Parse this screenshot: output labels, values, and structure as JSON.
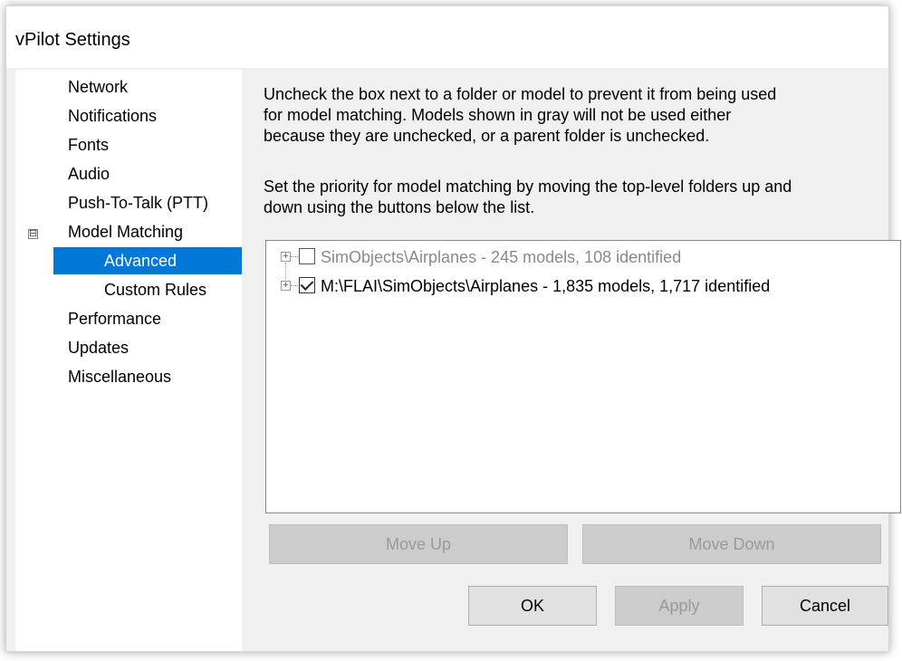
{
  "window": {
    "title": "vPilot Settings"
  },
  "nav": {
    "items": [
      {
        "label": "Network"
      },
      {
        "label": "Notifications"
      },
      {
        "label": "Fonts"
      },
      {
        "label": "Audio"
      },
      {
        "label": "Push-To-Talk (PTT)"
      },
      {
        "label": "Model Matching",
        "expander": "⊟"
      },
      {
        "label": "Advanced",
        "selected": true
      },
      {
        "label": "Custom Rules"
      },
      {
        "label": "Performance"
      },
      {
        "label": "Updates"
      },
      {
        "label": "Miscellaneous"
      }
    ]
  },
  "main": {
    "description_lines": [
      "Uncheck the box next to a folder or model to prevent it from being used",
      "for model matching. Models shown in gray will not be used either",
      "because they are unchecked, or a parent folder is unchecked."
    ],
    "priority_lines": [
      "Set the priority for model matching by moving the top-level folders up and",
      "down using the buttons below the list."
    ],
    "folders": [
      {
        "expander": "+",
        "checked": false,
        "label": "SimObjects\\Airplanes - 245 models, 108 identified"
      },
      {
        "expander": "+",
        "checked": true,
        "label": "M:\\FLAI\\SimObjects\\Airplanes - 1,835 models, 1,717 identified"
      }
    ]
  },
  "buttons": {
    "move_up": "Move Up",
    "move_down": "Move Down",
    "ok": "OK",
    "apply": "Apply",
    "cancel": "Cancel"
  }
}
